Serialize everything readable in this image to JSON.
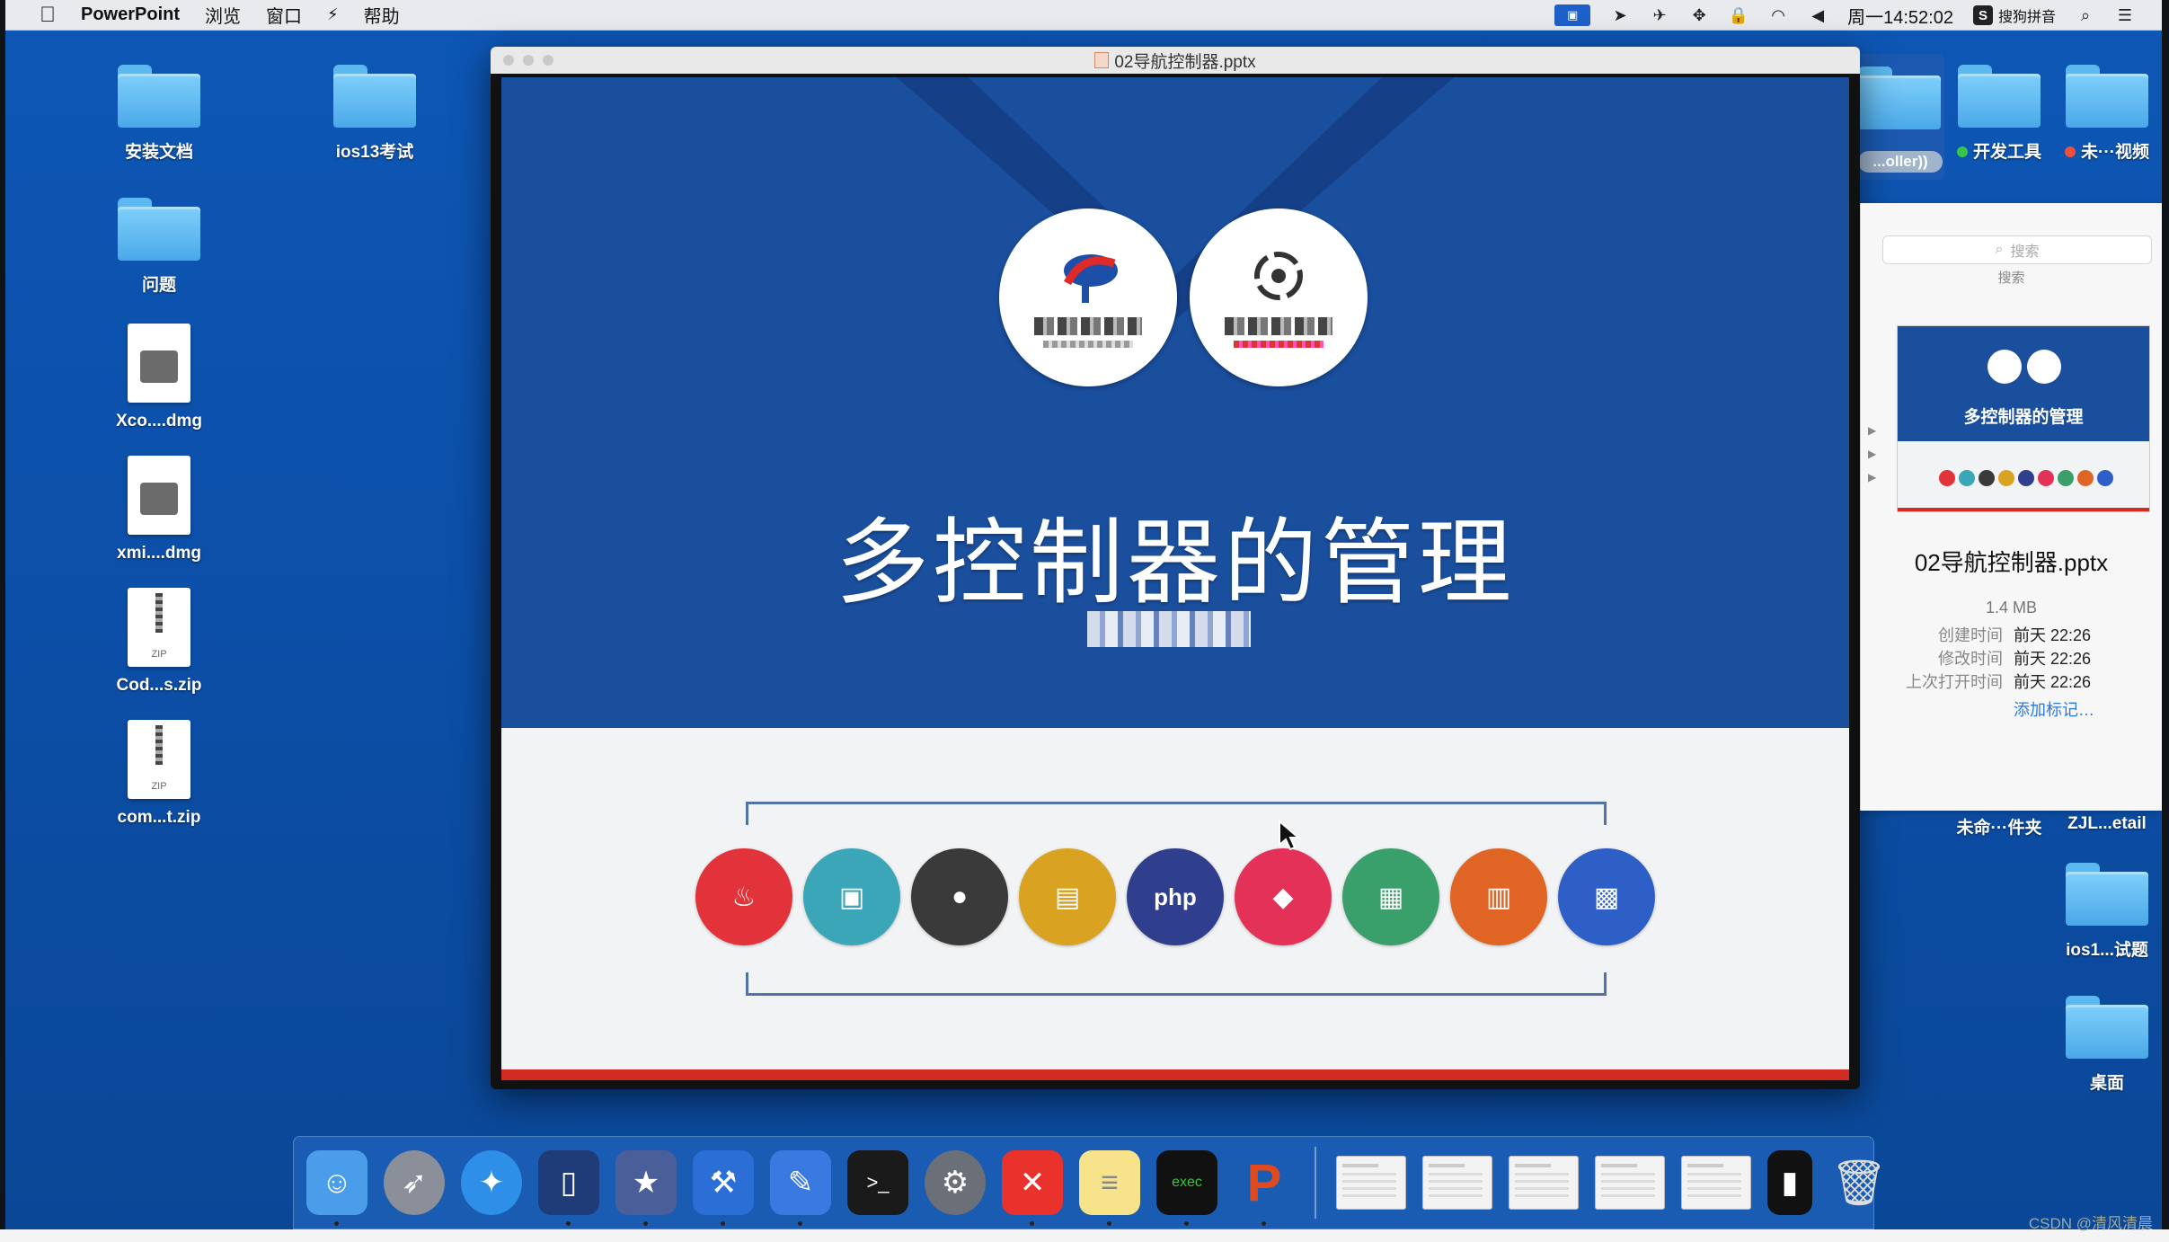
{
  "menubar": {
    "app_name": "PowerPoint",
    "menus": [
      "浏览",
      "窗口",
      "帮助"
    ],
    "clock": "周一14:52:02",
    "input_method": "搜狗拼音"
  },
  "desktop_left": [
    {
      "label": "安装文档",
      "kind": "folder"
    },
    {
      "label": "ios13考试",
      "kind": "folder"
    },
    {
      "label": "问题",
      "kind": "folder"
    },
    {
      "label": "Xco....dmg",
      "kind": "dmg"
    },
    {
      "label": "xmi....dmg",
      "kind": "dmg"
    },
    {
      "label": "Cod...s.zip",
      "kind": "zip"
    },
    {
      "label": "com...t.zip",
      "kind": "zip"
    }
  ],
  "desktop_right": {
    "top_labels": [
      "...oller))",
      "开发工具",
      "未···视频"
    ],
    "mid_labels": [
      "未命···件夹",
      "ZJL...etail"
    ],
    "lower": [
      {
        "label": "ios1...试题"
      },
      {
        "label": "桌面"
      }
    ]
  },
  "ppt_window": {
    "title": "02导航控制器.pptx",
    "slide": {
      "title": "多控制器的管理",
      "tech_icons": [
        {
          "name": "java",
          "color": "#e2333a",
          "glyph": "♨"
        },
        {
          "name": "android",
          "color": "#3aa6b8",
          "glyph": "▣"
        },
        {
          "name": "apple",
          "color": "#3a3a3a",
          "glyph": "●"
        },
        {
          "name": "ui",
          "color": "#d9a221",
          "glyph": "▤"
        },
        {
          "name": "php",
          "color": "#2f3f8e",
          "glyph": "php"
        },
        {
          "name": "html5",
          "color": "#e43157",
          "glyph": "◆"
        },
        {
          "name": "qa",
          "color": "#3aa06b",
          "glyph": "▦"
        },
        {
          "name": "design",
          "color": "#e06524",
          "glyph": "▥"
        },
        {
          "name": "cloud",
          "color": "#2e5fc7",
          "glyph": "▩"
        }
      ]
    }
  },
  "finder_preview": {
    "search_placeholder": "搜索",
    "search_label": "搜索",
    "thumb_title": "多控制器的管理",
    "file_name": "02导航控制器.pptx",
    "size": "1.4 MB",
    "meta": [
      {
        "key": "创建时间",
        "value": "前天 22:26"
      },
      {
        "key": "修改时间",
        "value": "前天 22:26"
      },
      {
        "key": "上次打开时间",
        "value": "前天 22:26"
      }
    ],
    "add_tags": "添加标记…",
    "tag_colors": {
      "开发工具": "#37c24a",
      "未···视频": "#f0503a"
    }
  },
  "dock": {
    "apps": [
      {
        "name": "finder",
        "glyph": "☺",
        "color": "#4a9de8"
      },
      {
        "name": "launchpad",
        "glyph": "🚀",
        "color": "#8a8f99"
      },
      {
        "name": "safari",
        "glyph": "✦",
        "color": "#2e8fe8"
      },
      {
        "name": "mouse",
        "glyph": "▯",
        "color": "#1f3b78"
      },
      {
        "name": "imovie",
        "glyph": "★",
        "color": "#4a5f9a"
      },
      {
        "name": "xcode",
        "glyph": "⚒",
        "color": "#2b6fd6"
      },
      {
        "name": "instruments",
        "glyph": "✎",
        "color": "#3a7ae0"
      },
      {
        "name": "terminal",
        "glyph": ">_",
        "color": "#1a1a1a"
      },
      {
        "name": "system-preferences",
        "glyph": "⚙",
        "color": "#6b7078"
      },
      {
        "name": "xmind",
        "glyph": "✕",
        "color": "#e8322b"
      },
      {
        "name": "notes",
        "glyph": "≡",
        "color": "#f7e48a"
      },
      {
        "name": "exec",
        "glyph": "exec",
        "color": "#111111"
      },
      {
        "name": "powerpoint",
        "glyph": "P",
        "color": "#e04a1e"
      }
    ],
    "watermark": "CSDN @清风清晨"
  }
}
